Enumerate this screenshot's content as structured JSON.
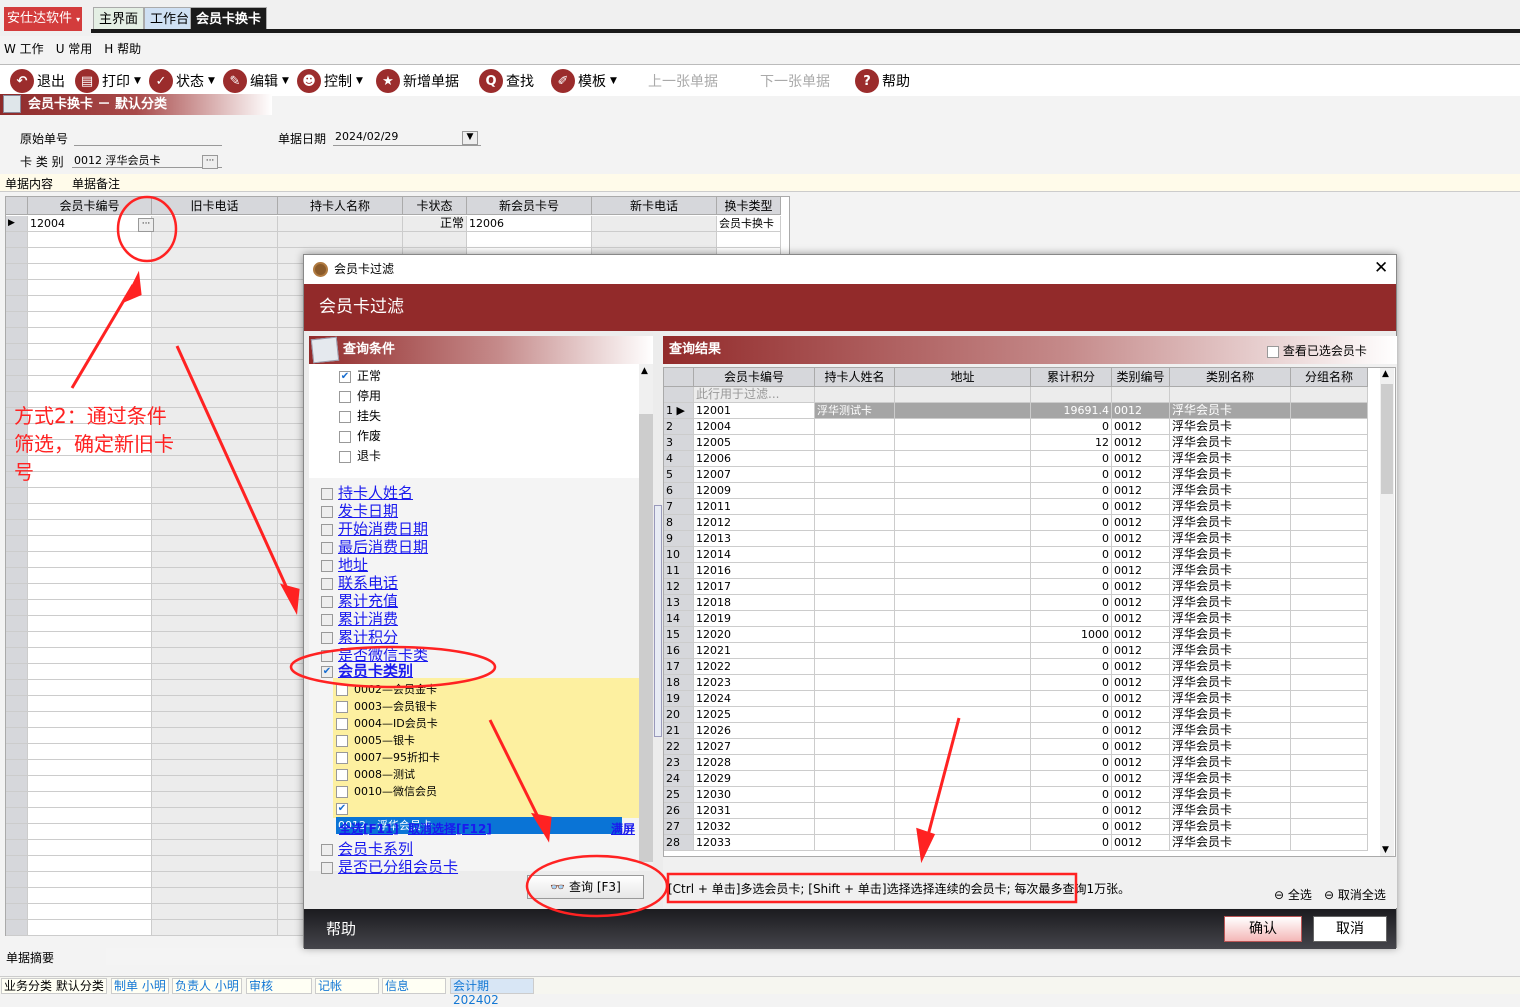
{
  "app": {
    "brand": "安仕达软件",
    "tabs": [
      "主界面",
      "工作台",
      "会员卡换卡"
    ]
  },
  "menu": [
    "W 工作",
    "U 常用",
    "H 帮助"
  ],
  "toolbar": {
    "exit": "退出",
    "print": "打印",
    "status": "状态",
    "edit": "编辑",
    "control": "控制",
    "new_doc": "新增单据",
    "find": "查找",
    "template": "模板",
    "prev": "上一张单据",
    "next": "下一张单据",
    "help": "帮助"
  },
  "page_title": "会员卡换卡 － 默认分类",
  "form": {
    "orig_no_label": "原始单号",
    "orig_no": "",
    "date_label": "单据日期",
    "date": "2024/02/29",
    "card_type_label": "卡 类 别",
    "card_type": "0012 浮华会员卡"
  },
  "subtabs": [
    "单据内容",
    "单据备注"
  ],
  "grid": {
    "columns": [
      "会员卡编号",
      "旧卡电话",
      "持卡人名称",
      "卡状态",
      "新会员卡号",
      "新卡电话",
      "换卡类型"
    ],
    "rows": [
      [
        "12004",
        "",
        "",
        "正常",
        "12006",
        "",
        "会员卡换卡"
      ]
    ]
  },
  "summary_label": "单据摘要",
  "statusbar": [
    "业务分类 默认分类",
    "制单 小明",
    "负责人 小明",
    "审核",
    "记帐",
    "信息",
    "会计期 202402"
  ],
  "dialog": {
    "title": "会员卡过滤",
    "header": "会员卡过滤",
    "cond_title": "查询条件",
    "statuses": [
      {
        "label": "正常",
        "checked": true
      },
      {
        "label": "停用",
        "checked": false
      },
      {
        "label": "挂失",
        "checked": false
      },
      {
        "label": "作废",
        "checked": false
      },
      {
        "label": "退卡",
        "checked": false
      }
    ],
    "conditions": [
      "持卡人姓名",
      "发卡日期",
      "开始消费日期",
      "最后消费日期",
      "地址",
      "联系电话",
      "累计充值",
      "累计消费",
      "累计积分",
      "是否微信卡类"
    ],
    "card_type_cond": "会员卡类别",
    "categories": [
      {
        "label": "0002—会员金卡",
        "checked": false
      },
      {
        "label": "0003—会员银卡",
        "checked": false
      },
      {
        "label": "0004—ID会员卡",
        "checked": false
      },
      {
        "label": "0005—银卡",
        "checked": false
      },
      {
        "label": "0007—95折扣卡",
        "checked": false
      },
      {
        "label": "0008—测试",
        "checked": false
      },
      {
        "label": "0010—微信会员",
        "checked": false
      },
      {
        "label": "0012—浮华会员卡",
        "checked": true
      }
    ],
    "select_all": "全选[F11]",
    "deselect": "取消选择[F12]",
    "fullscreen": "满屏",
    "more_conditions": [
      "会员卡系列",
      "是否已分组会员卡"
    ],
    "query_btn": "查询 [F3]",
    "result_title": "查询结果",
    "view_selected": "查看已选会员卡",
    "result_columns": [
      "会员卡编号",
      "持卡人姓名",
      "地址",
      "累计积分",
      "类别编号",
      "类别名称",
      "分组名称"
    ],
    "filter_placeholder": "此行用于过滤...",
    "results": [
      [
        "12001",
        "浮华测试卡",
        "",
        "19691.4",
        "0012",
        "浮华会员卡",
        ""
      ],
      [
        "12004",
        "",
        "",
        "0",
        "0012",
        "浮华会员卡",
        ""
      ],
      [
        "12005",
        "",
        "",
        "12",
        "0012",
        "浮华会员卡",
        ""
      ],
      [
        "12006",
        "",
        "",
        "0",
        "0012",
        "浮华会员卡",
        ""
      ],
      [
        "12007",
        "",
        "",
        "0",
        "0012",
        "浮华会员卡",
        ""
      ],
      [
        "12009",
        "",
        "",
        "0",
        "0012",
        "浮华会员卡",
        ""
      ],
      [
        "12011",
        "",
        "",
        "0",
        "0012",
        "浮华会员卡",
        ""
      ],
      [
        "12012",
        "",
        "",
        "0",
        "0012",
        "浮华会员卡",
        ""
      ],
      [
        "12013",
        "",
        "",
        "0",
        "0012",
        "浮华会员卡",
        ""
      ],
      [
        "12014",
        "",
        "",
        "0",
        "0012",
        "浮华会员卡",
        ""
      ],
      [
        "12016",
        "",
        "",
        "0",
        "0012",
        "浮华会员卡",
        ""
      ],
      [
        "12017",
        "",
        "",
        "0",
        "0012",
        "浮华会员卡",
        ""
      ],
      [
        "12018",
        "",
        "",
        "0",
        "0012",
        "浮华会员卡",
        ""
      ],
      [
        "12019",
        "",
        "",
        "0",
        "0012",
        "浮华会员卡",
        ""
      ],
      [
        "12020",
        "",
        "",
        "1000",
        "0012",
        "浮华会员卡",
        ""
      ],
      [
        "12021",
        "",
        "",
        "0",
        "0012",
        "浮华会员卡",
        ""
      ],
      [
        "12022",
        "",
        "",
        "0",
        "0012",
        "浮华会员卡",
        ""
      ],
      [
        "12023",
        "",
        "",
        "0",
        "0012",
        "浮华会员卡",
        ""
      ],
      [
        "12024",
        "",
        "",
        "0",
        "0012",
        "浮华会员卡",
        ""
      ],
      [
        "12025",
        "",
        "",
        "0",
        "0012",
        "浮华会员卡",
        ""
      ],
      [
        "12026",
        "",
        "",
        "0",
        "0012",
        "浮华会员卡",
        ""
      ],
      [
        "12027",
        "",
        "",
        "0",
        "0012",
        "浮华会员卡",
        ""
      ],
      [
        "12028",
        "",
        "",
        "0",
        "0012",
        "浮华会员卡",
        ""
      ],
      [
        "12029",
        "",
        "",
        "0",
        "0012",
        "浮华会员卡",
        ""
      ],
      [
        "12030",
        "",
        "",
        "0",
        "0012",
        "浮华会员卡",
        ""
      ],
      [
        "12031",
        "",
        "",
        "0",
        "0012",
        "浮华会员卡",
        ""
      ],
      [
        "12032",
        "",
        "",
        "0",
        "0012",
        "浮华会员卡",
        ""
      ],
      [
        "12033",
        "",
        "",
        "0",
        "0012",
        "浮华会员卡",
        ""
      ]
    ],
    "hint": "[Ctrl + 单击]多选会员卡; [Shift + 单击]选择选择连续的会员卡; 每次最多查询1万张。",
    "all": "全选",
    "none": "取消全选",
    "footer_help": "帮助",
    "ok": "确认",
    "cancel": "取消"
  },
  "annotation": "方式2：通过条件筛选，确定新旧卡号",
  "colors": {
    "brand_red": "#922a2a",
    "annotation_red": "#ff2222",
    "selection_blue": "#0a74d6"
  }
}
